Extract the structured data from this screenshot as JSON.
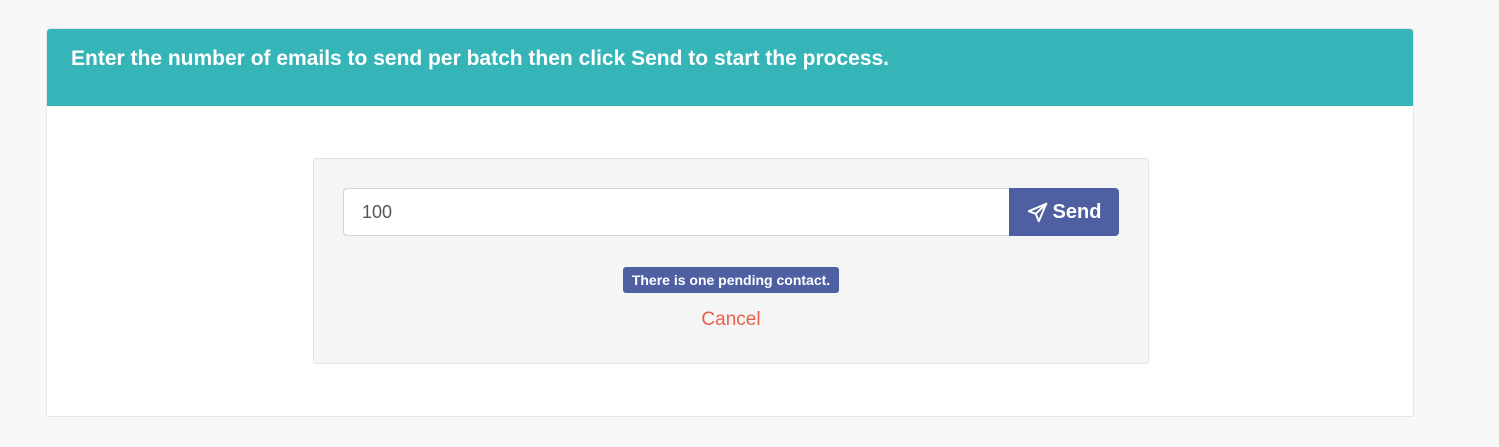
{
  "header": {
    "instruction": "Enter the number of emails to send per batch then click Send to start the process."
  },
  "batch_form": {
    "batch_size_value": "100",
    "send_label": "Send",
    "send_icon": "paper-plane-icon"
  },
  "status": {
    "pending_message": "There is one pending contact."
  },
  "actions": {
    "cancel_label": "Cancel"
  },
  "colors": {
    "header_bg": "#36b5b9",
    "primary": "#4e5fa2",
    "cancel": "#e8604a"
  }
}
